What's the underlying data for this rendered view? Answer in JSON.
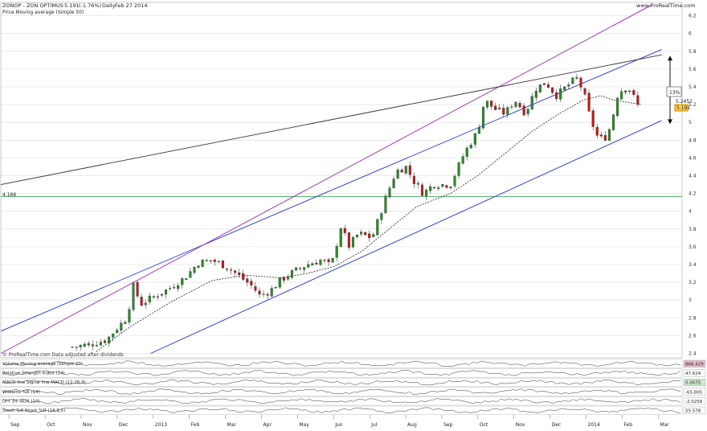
{
  "header": {
    "title": "ZONOP - ZON OPTIMUS",
    "price": "5.191",
    "change": "(-1.76%)",
    "period": "Daily",
    "date": "Feb 27 2014",
    "site": "www.ProRealTime.com",
    "indicator_label": "Price Moving average (Simple 50)"
  },
  "footer_note": "© ProRealTime.com Data adjusted after dividends",
  "colors": {
    "bull": "#2b8a2b",
    "bear": "#c21a1a",
    "channel": "#1f2fd6",
    "outer_line": "#9b27b0",
    "resistance": "#333333",
    "support_h": "#2e9e4a",
    "grid": "#dcdcdc"
  },
  "chart_data": {
    "type": "candlestick",
    "ylim": [
      2.35,
      6.35
    ],
    "y_ticks": [
      "2.4",
      "2.6",
      "2.8",
      "3",
      "3.2",
      "3.4",
      "3.6",
      "3.8",
      "4",
      "4.2",
      "4.4",
      "4.6",
      "4.8",
      "5",
      "5.2",
      "5.4",
      "5.6",
      "5.8",
      "6",
      "6.2"
    ],
    "x_ticks": [
      "Sep",
      "Oct",
      "Nov",
      "Dec",
      "2013",
      "Feb",
      "Mar",
      "Apr",
      "May",
      "Jun",
      "Jul",
      "Aug",
      "Sep",
      "Oct",
      "Nov",
      "Dec",
      "2014",
      "Feb",
      "Mar"
    ],
    "horizontal_level": {
      "label": "4.166",
      "value": 4.166
    },
    "price_labels": [
      "5.2452",
      "5.191"
    ],
    "annotation": "13%",
    "close_path": [
      [
        0.105,
        2.47
      ],
      [
        0.13,
        2.5
      ],
      [
        0.155,
        2.55
      ],
      [
        0.175,
        2.72
      ],
      [
        0.185,
        2.8
      ],
      [
        0.195,
        3.17
      ],
      [
        0.205,
        2.95
      ],
      [
        0.22,
        3.02
      ],
      [
        0.245,
        3.12
      ],
      [
        0.27,
        3.25
      ],
      [
        0.29,
        3.42
      ],
      [
        0.31,
        3.45
      ],
      [
        0.33,
        3.38
      ],
      [
        0.345,
        3.3
      ],
      [
        0.37,
        3.15
      ],
      [
        0.38,
        3.05
      ],
      [
        0.395,
        3.1
      ],
      [
        0.41,
        3.22
      ],
      [
        0.43,
        3.32
      ],
      [
        0.45,
        3.4
      ],
      [
        0.47,
        3.45
      ],
      [
        0.485,
        3.38
      ],
      [
        0.5,
        3.85
      ],
      [
        0.51,
        3.6
      ],
      [
        0.525,
        3.75
      ],
      [
        0.545,
        3.7
      ],
      [
        0.565,
        4.15
      ],
      [
        0.58,
        4.45
      ],
      [
        0.595,
        4.5
      ],
      [
        0.605,
        4.35
      ],
      [
        0.62,
        4.2
      ],
      [
        0.635,
        4.3
      ],
      [
        0.66,
        4.3
      ],
      [
        0.68,
        4.65
      ],
      [
        0.7,
        4.9
      ],
      [
        0.71,
        5.25
      ],
      [
        0.725,
        5.15
      ],
      [
        0.74,
        5.1
      ],
      [
        0.755,
        5.25
      ],
      [
        0.77,
        5.1
      ],
      [
        0.785,
        5.38
      ],
      [
        0.8,
        5.45
      ],
      [
        0.815,
        5.3
      ],
      [
        0.83,
        5.4
      ],
      [
        0.845,
        5.5
      ],
      [
        0.855,
        5.35
      ],
      [
        0.865,
        5.05
      ],
      [
        0.875,
        4.85
      ],
      [
        0.885,
        4.8
      ],
      [
        0.895,
        4.95
      ],
      [
        0.905,
        5.3
      ],
      [
        0.915,
        5.4
      ],
      [
        0.925,
        5.35
      ],
      [
        0.935,
        5.19
      ]
    ],
    "sma50_path": [
      [
        0.14,
        2.42
      ],
      [
        0.19,
        2.7
      ],
      [
        0.25,
        2.98
      ],
      [
        0.31,
        3.22
      ],
      [
        0.36,
        3.28
      ],
      [
        0.41,
        3.25
      ],
      [
        0.45,
        3.3
      ],
      [
        0.49,
        3.38
      ],
      [
        0.53,
        3.55
      ],
      [
        0.57,
        3.8
      ],
      [
        0.61,
        4.05
      ],
      [
        0.66,
        4.2
      ],
      [
        0.7,
        4.4
      ],
      [
        0.74,
        4.65
      ],
      [
        0.78,
        4.9
      ],
      [
        0.82,
        5.1
      ],
      [
        0.855,
        5.25
      ],
      [
        0.88,
        5.3
      ],
      [
        0.9,
        5.25
      ],
      [
        0.925,
        5.22
      ],
      [
        0.94,
        5.2
      ]
    ],
    "candle_count": 140,
    "trend_lines": [
      {
        "name": "channel-upper",
        "from": [
          0.0,
          2.65
        ],
        "to": [
          0.97,
          5.82
        ],
        "color": "channel"
      },
      {
        "name": "channel-lower",
        "from": [
          0.22,
          2.4
        ],
        "to": [
          0.97,
          5.02
        ],
        "color": "channel"
      },
      {
        "name": "outer-upper",
        "from": [
          0.0,
          2.4
        ],
        "to": [
          0.955,
          6.32
        ],
        "color": "outer_line"
      },
      {
        "name": "resistance",
        "from": [
          0.0,
          4.3
        ],
        "to": [
          0.97,
          5.76
        ],
        "color": "resistance"
      }
    ],
    "arrow": {
      "from": 5.75,
      "to": 4.98
    }
  },
  "indicators": [
    {
      "name": "volume",
      "label": "Volume Moving average (Simple 20)",
      "value": "866,429",
      "badge_color": "#e7bfc8"
    },
    {
      "name": "rsi",
      "label": "Relative Strength Index (14)",
      "value": "47.624",
      "badge_color": "#ffffff"
    },
    {
      "name": "macd",
      "label": "MACD line Signal line MACD (12,26,9)",
      "value": "0.0075",
      "badge_color": "#cfe9cf"
    },
    {
      "name": "williams",
      "label": "Williams %R (14)",
      "value": "-65.805",
      "badge_color": "#ffffff"
    },
    {
      "name": "adx",
      "label": "DI+ DI- ADX (14)",
      "value": "-2.0258",
      "badge_color": "#ffffff"
    },
    {
      "name": "stoch",
      "label": "Stoch %K Stoch %D (14,3,5)",
      "value": "55.578",
      "badge_color": "#ffffff"
    }
  ]
}
